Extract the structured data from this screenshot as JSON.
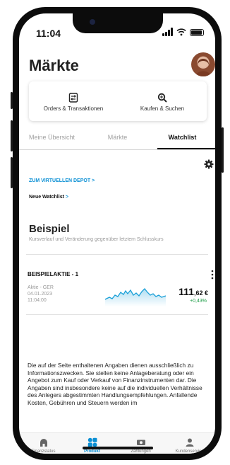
{
  "status_bar": {
    "time": "11:04"
  },
  "header": {
    "title": "Märkte"
  },
  "quick_actions": [
    {
      "label": "Orders & Transaktionen",
      "icon": "orders-icon"
    },
    {
      "label": "Kaufen & Suchen",
      "icon": "search-icon"
    }
  ],
  "tabs": [
    {
      "label": "Meine Übersicht",
      "active": false
    },
    {
      "label": "Märkte",
      "active": false
    },
    {
      "label": "Watchlist",
      "active": true
    }
  ],
  "links": {
    "depot": "ZUM VIRTUELLEN DEPOT",
    "new_watchlist": "Neue Watchlist",
    "chevron": ">"
  },
  "watchlist": {
    "title": "Beispiel",
    "subtitle": "Kursverlauf und Veränderung gegenüber letztem Schlusskurs"
  },
  "stock": {
    "name": "BEISPIELAKTIE - 1",
    "market": "Aktie - GER",
    "date": "04.01.2023",
    "time": "11:04:00",
    "price_main": "111",
    "price_decimals": ",62 €",
    "change": "+0,43%",
    "change_color": "#1a9c45",
    "sparkline_color": "#1aa0d8"
  },
  "disclaimer": "Die auf der Seite enthaltenen Angaben dienen ausschließlich zu Informationszwecken. Sie stellen keine Anlageberatung oder ein Angebot zum Kauf oder Verkauf von Finanzinstrumenten dar. Die Angaben sind insbesondere keine auf die individuellen Verhältnisse des Anlegers abgestimmten Handlungsempfehlungen. Anfallende Kosten, Gebühren und Steuern werden im",
  "bottom_nav": [
    {
      "label": "Finanzstatus",
      "icon": "bank-icon",
      "active": false
    },
    {
      "label": "Produkt",
      "icon": "product-icon",
      "active": true
    },
    {
      "label": "Zahlungen",
      "icon": "payments-icon",
      "active": false
    },
    {
      "label": "Kundenservice",
      "icon": "customer-service-icon",
      "active": false
    }
  ],
  "colors": {
    "accent": "#0a8fd4",
    "text": "#222222",
    "muted": "#999999"
  }
}
